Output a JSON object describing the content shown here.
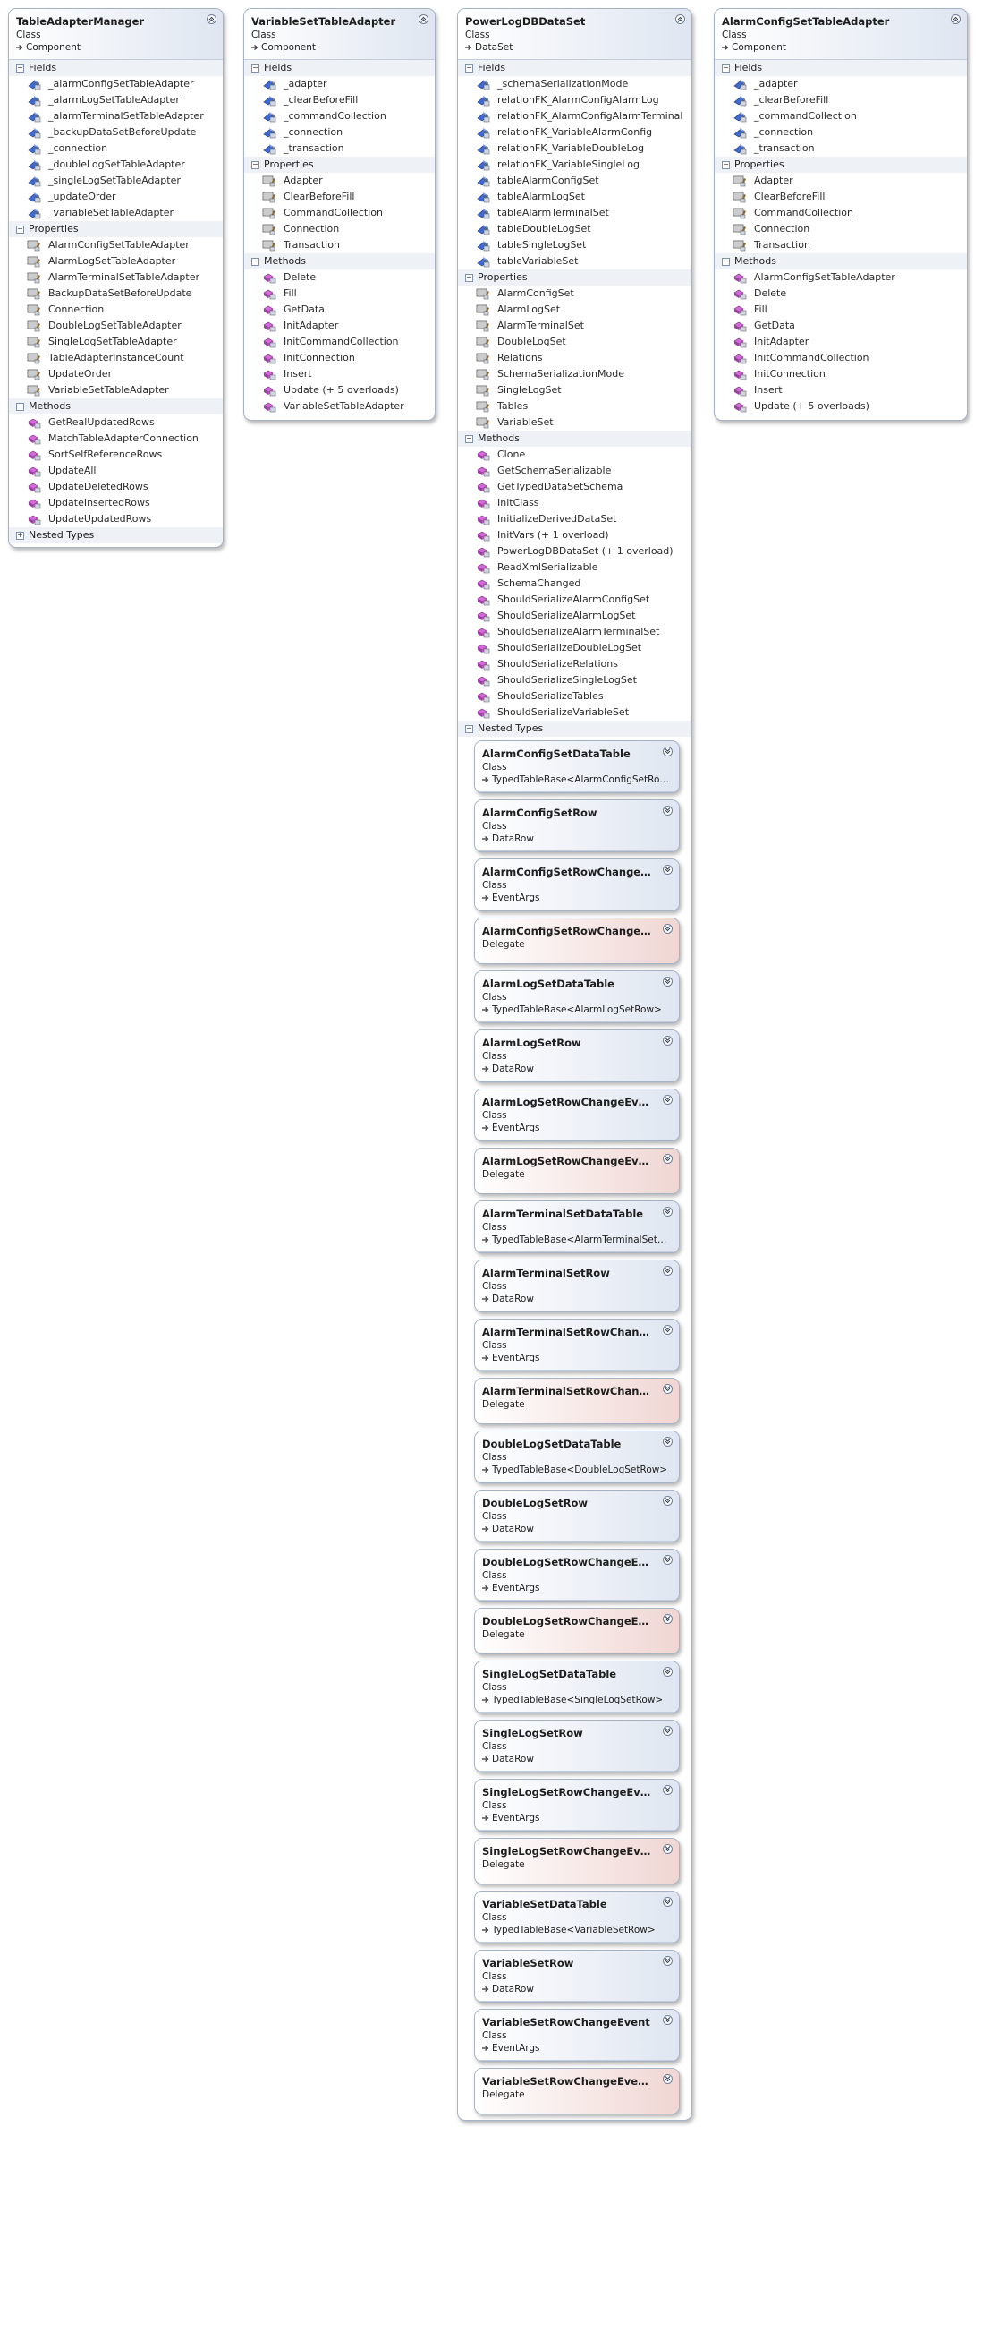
{
  "shapes": [
    {
      "id": "table-adapter-manager",
      "title": "TableAdapterManager",
      "kind": "Class",
      "base": "Component",
      "sections": [
        {
          "label": "Fields",
          "items": [
            "_alarmConfigSetTableAdapter",
            "_alarmLogSetTableAdapter",
            "_alarmTerminalSetTableAdapter",
            "_backupDataSetBeforeUpdate",
            "_connection",
            "_doubleLogSetTableAdapter",
            "_singleLogSetTableAdapter",
            "_updateOrder",
            "_variableSetTableAdapter"
          ],
          "icon": "field"
        },
        {
          "label": "Properties",
          "items": [
            "AlarmConfigSetTableAdapter",
            "AlarmLogSetTableAdapter",
            "AlarmTerminalSetTableAdapter",
            "BackupDataSetBeforeUpdate",
            "Connection",
            "DoubleLogSetTableAdapter",
            "SingleLogSetTableAdapter",
            "TableAdapterInstanceCount",
            "UpdateOrder",
            "VariableSetTableAdapter"
          ],
          "icon": "property"
        },
        {
          "label": "Methods",
          "items": [
            "GetRealUpdatedRows",
            "MatchTableAdapterConnection",
            "SortSelfReferenceRows",
            "UpdateAll",
            "UpdateDeletedRows",
            "UpdateInsertedRows",
            "UpdateUpdatedRows"
          ],
          "icon": "method"
        }
      ],
      "nested_label": "Nested Types",
      "nested_collapsed": true
    },
    {
      "id": "variable-set-table-adapter",
      "title": "VariableSetTableAdapter",
      "kind": "Class",
      "base": "Component",
      "sections": [
        {
          "label": "Fields",
          "items": [
            "_adapter",
            "_clearBeforeFill",
            "_commandCollection",
            "_connection",
            "_transaction"
          ],
          "icon": "field"
        },
        {
          "label": "Properties",
          "items": [
            "Adapter",
            "ClearBeforeFill",
            "CommandCollection",
            "Connection",
            "Transaction"
          ],
          "icon": "property"
        },
        {
          "label": "Methods",
          "items": [
            "Delete",
            "Fill",
            "GetData",
            "InitAdapter",
            "InitCommandCollection",
            "InitConnection",
            "Insert",
            "Update (+ 5 overloads)",
            "VariableSetTableAdapter"
          ],
          "icon": "method"
        }
      ]
    },
    {
      "id": "power-log-db-dataset",
      "title": "PowerLogDBDataSet",
      "kind": "Class",
      "base": "DataSet",
      "sections": [
        {
          "label": "Fields",
          "items": [
            "_schemaSerializationMode",
            "relationFK_AlarmConfigAlarmLog",
            "relationFK_AlarmConfigAlarmTerminal",
            "relationFK_VariableAlarmConfig",
            "relationFK_VariableDoubleLog",
            "relationFK_VariableSingleLog",
            "tableAlarmConfigSet",
            "tableAlarmLogSet",
            "tableAlarmTerminalSet",
            "tableDoubleLogSet",
            "tableSingleLogSet",
            "tableVariableSet"
          ],
          "icon": "field"
        },
        {
          "label": "Properties",
          "items": [
            "AlarmConfigSet",
            "AlarmLogSet",
            "AlarmTerminalSet",
            "DoubleLogSet",
            "Relations",
            "SchemaSerializationMode",
            "SingleLogSet",
            "Tables",
            "VariableSet"
          ],
          "icon": "property"
        },
        {
          "label": "Methods",
          "items": [
            "Clone",
            "GetSchemaSerializable",
            "GetTypedDataSetSchema",
            "InitClass",
            "InitializeDerivedDataSet",
            "InitVars (+ 1 overload)",
            "PowerLogDBDataSet (+ 1 overload)",
            "ReadXmlSerializable",
            "SchemaChanged",
            "ShouldSerializeAlarmConfigSet",
            "ShouldSerializeAlarmLogSet",
            "ShouldSerializeAlarmTerminalSet",
            "ShouldSerializeDoubleLogSet",
            "ShouldSerializeRelations",
            "ShouldSerializeSingleLogSet",
            "ShouldSerializeTables",
            "ShouldSerializeVariableSet"
          ],
          "icon": "method"
        }
      ],
      "nested_label": "Nested Types",
      "nested_types": [
        {
          "title": "AlarmConfigSetDataTable",
          "kind": "Class",
          "base": "TypedTableBase<AlarmConfigSetRow>",
          "delegate": false
        },
        {
          "title": "AlarmConfigSetRow",
          "kind": "Class",
          "base": "DataRow",
          "delegate": false
        },
        {
          "title": "AlarmConfigSetRowChangeEvent",
          "kind": "Class",
          "base": "EventArgs",
          "delegate": false
        },
        {
          "title": "AlarmConfigSetRowChangeEve...",
          "kind": "Delegate",
          "base": "",
          "delegate": true
        },
        {
          "title": "AlarmLogSetDataTable",
          "kind": "Class",
          "base": "TypedTableBase<AlarmLogSetRow>",
          "delegate": false
        },
        {
          "title": "AlarmLogSetRow",
          "kind": "Class",
          "base": "DataRow",
          "delegate": false
        },
        {
          "title": "AlarmLogSetRowChangeEvent",
          "kind": "Class",
          "base": "EventArgs",
          "delegate": false
        },
        {
          "title": "AlarmLogSetRowChangeEvent...",
          "kind": "Delegate",
          "base": "",
          "delegate": true
        },
        {
          "title": "AlarmTerminalSetDataTable",
          "kind": "Class",
          "base": "TypedTableBase<AlarmTerminalSetRow>",
          "delegate": false
        },
        {
          "title": "AlarmTerminalSetRow",
          "kind": "Class",
          "base": "DataRow",
          "delegate": false
        },
        {
          "title": "AlarmTerminalSetRowChangeE...",
          "kind": "Class",
          "base": "EventArgs",
          "delegate": false
        },
        {
          "title": "AlarmTerminalSetRowChangeE...",
          "kind": "Delegate",
          "base": "",
          "delegate": true
        },
        {
          "title": "DoubleLogSetDataTable",
          "kind": "Class",
          "base": "TypedTableBase<DoubleLogSetRow>",
          "delegate": false
        },
        {
          "title": "DoubleLogSetRow",
          "kind": "Class",
          "base": "DataRow",
          "delegate": false
        },
        {
          "title": "DoubleLogSetRowChangeEvent",
          "kind": "Class",
          "base": "EventArgs",
          "delegate": false
        },
        {
          "title": "DoubleLogSetRowChangeEvent...",
          "kind": "Delegate",
          "base": "",
          "delegate": true
        },
        {
          "title": "SingleLogSetDataTable",
          "kind": "Class",
          "base": "TypedTableBase<SingleLogSetRow>",
          "delegate": false
        },
        {
          "title": "SingleLogSetRow",
          "kind": "Class",
          "base": "DataRow",
          "delegate": false
        },
        {
          "title": "SingleLogSetRowChangeEvent",
          "kind": "Class",
          "base": "EventArgs",
          "delegate": false
        },
        {
          "title": "SingleLogSetRowChangeEvent...",
          "kind": "Delegate",
          "base": "",
          "delegate": true
        },
        {
          "title": "VariableSetDataTable",
          "kind": "Class",
          "base": "TypedTableBase<VariableSetRow>",
          "delegate": false
        },
        {
          "title": "VariableSetRow",
          "kind": "Class",
          "base": "DataRow",
          "delegate": false
        },
        {
          "title": "VariableSetRowChangeEvent",
          "kind": "Class",
          "base": "EventArgs",
          "delegate": false
        },
        {
          "title": "VariableSetRowChangeEventHa...",
          "kind": "Delegate",
          "base": "",
          "delegate": true
        }
      ]
    },
    {
      "id": "alarm-config-set-table-adapter",
      "title": "AlarmConfigSetTableAdapter",
      "kind": "Class",
      "base": "Component",
      "sections": [
        {
          "label": "Fields",
          "items": [
            "_adapter",
            "_clearBeforeFill",
            "_commandCollection",
            "_connection",
            "_transaction"
          ],
          "icon": "field"
        },
        {
          "label": "Properties",
          "items": [
            "Adapter",
            "ClearBeforeFill",
            "CommandCollection",
            "Connection",
            "Transaction"
          ],
          "icon": "property"
        },
        {
          "label": "Methods",
          "items": [
            "AlarmConfigSetTableAdapter",
            "Delete",
            "Fill",
            "GetData",
            "InitAdapter",
            "InitCommandCollection",
            "InitConnection",
            "Insert",
            "Update (+ 5 overloads)"
          ],
          "icon": "method"
        }
      ]
    }
  ],
  "colors": {
    "field": "#3b63c4",
    "property": "#5d5d5d",
    "method": "#b04fb8",
    "delegate_bg": "#f0d6d3",
    "header_bg": "#dfe6f1"
  },
  "icons": {
    "collapse": "double-chevron-up-icon",
    "expand": "double-chevron-down-icon",
    "inherits": "arrow-right-icon"
  }
}
